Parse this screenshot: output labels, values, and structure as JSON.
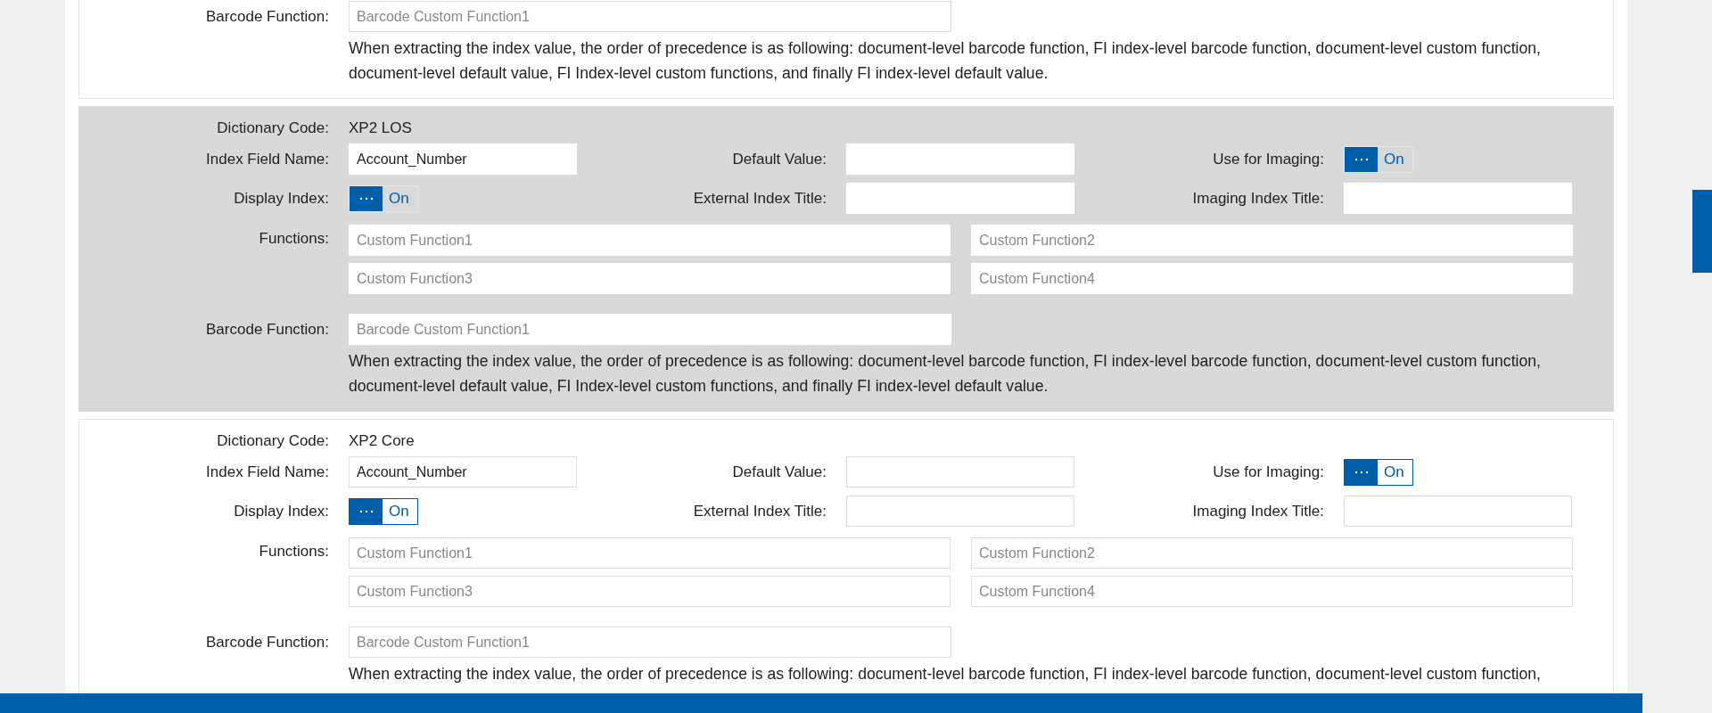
{
  "cards": [
    {
      "selected": false,
      "barcode_function": {
        "label": "Barcode Function:",
        "placeholder": "Barcode Custom Function1"
      },
      "description": "When extracting the index value, the order of precedence is as following: document-level barcode function, FI index-level barcode function, document-level custom function, document-level default value, FI Index-level custom functions, and finally FI index-level default value."
    },
    {
      "selected": true,
      "dictionary_code": {
        "label": "Dictionary Code:",
        "value": "XP2 LOS"
      },
      "index_field_name": {
        "label": "Index Field Name:",
        "value": "Account_Number"
      },
      "default_value": {
        "label": "Default Value:"
      },
      "use_for_imaging": {
        "label": "Use for Imaging:",
        "on": true,
        "state_text": "On"
      },
      "display_index": {
        "label": "Display Index:",
        "on": true,
        "state_text": "On"
      },
      "external_index_title": {
        "label": "External Index Title:"
      },
      "imaging_index_title": {
        "label": "Imaging Index Title:"
      },
      "functions": {
        "label": "Functions:",
        "placeholders": [
          "Custom Function1",
          "Custom Function2",
          "Custom Function3",
          "Custom Function4"
        ]
      },
      "barcode_function": {
        "label": "Barcode Function:",
        "placeholder": "Barcode Custom Function1"
      },
      "description": "When extracting the index value, the order of precedence is as following: document-level barcode function, FI index-level barcode function, document-level custom function, document-level default value, FI Index-level custom functions, and finally FI index-level default value."
    },
    {
      "selected": false,
      "dictionary_code": {
        "label": "Dictionary Code:",
        "value": "XP2 Core"
      },
      "index_field_name": {
        "label": "Index Field Name:",
        "value": "Account_Number"
      },
      "default_value": {
        "label": "Default Value:"
      },
      "use_for_imaging": {
        "label": "Use for Imaging:",
        "on": true,
        "state_text": "On"
      },
      "display_index": {
        "label": "Display Index:",
        "on": true,
        "state_text": "On"
      },
      "external_index_title": {
        "label": "External Index Title:"
      },
      "imaging_index_title": {
        "label": "Imaging Index Title:"
      },
      "functions": {
        "label": "Functions:",
        "placeholders": [
          "Custom Function1",
          "Custom Function2",
          "Custom Function3",
          "Custom Function4"
        ]
      },
      "barcode_function": {
        "label": "Barcode Function:",
        "placeholder": "Barcode Custom Function1"
      },
      "description": "When extracting the index value, the order of precedence is as following: document-level barcode function, FI index-level barcode function, document-level custom function,"
    }
  ]
}
